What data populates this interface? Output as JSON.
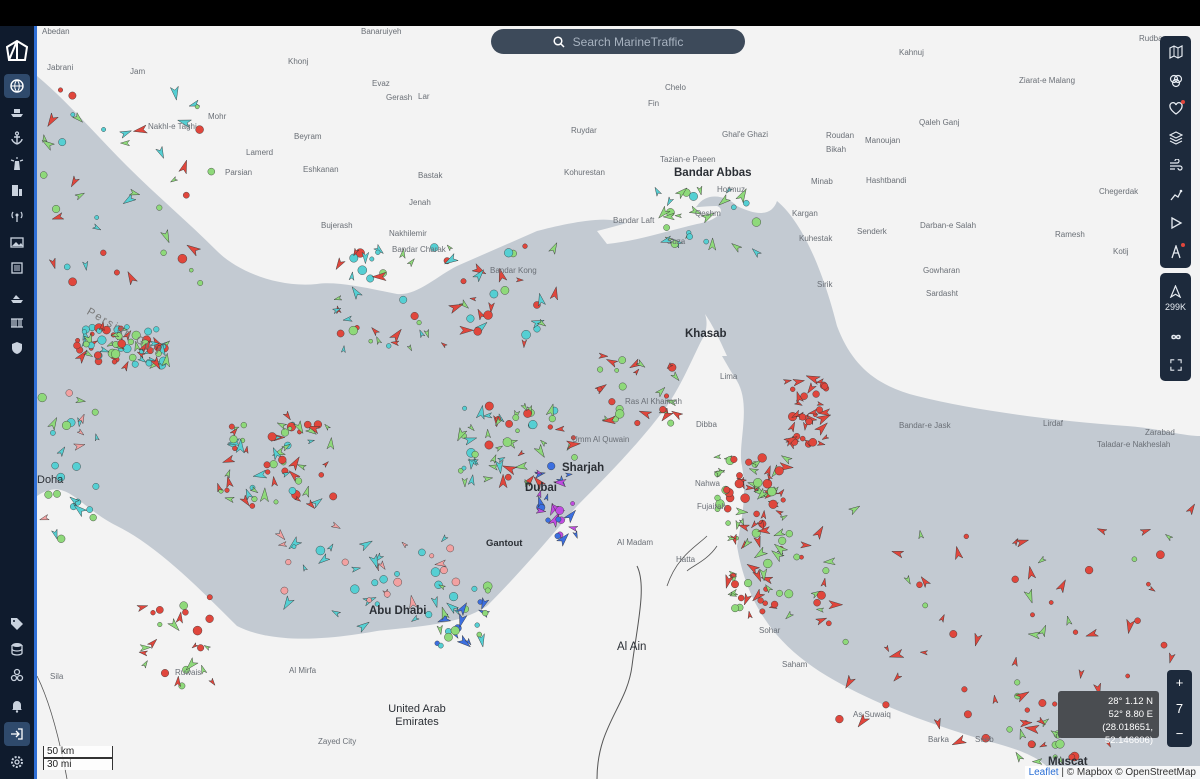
{
  "search": {
    "placeholder": "Search MarineTraffic"
  },
  "sidebar": {
    "items": [
      {
        "icon": "globe-icon",
        "active": true
      },
      {
        "icon": "ship-icon"
      },
      {
        "icon": "anchor-icon"
      },
      {
        "icon": "lighthouse-icon"
      },
      {
        "icon": "building-icon"
      },
      {
        "icon": "antenna-icon"
      },
      {
        "icon": "photo-icon"
      },
      {
        "icon": "news-icon"
      },
      {
        "icon": "fleet-icon"
      },
      {
        "icon": "barcode-icon"
      },
      {
        "icon": "shield-icon"
      }
    ],
    "bottom_items": [
      {
        "icon": "tag-icon"
      },
      {
        "icon": "database-icon"
      },
      {
        "icon": "cubes-icon"
      },
      {
        "icon": "bell-icon"
      },
      {
        "icon": "login-icon",
        "active": true
      },
      {
        "icon": "settings-icon"
      }
    ]
  },
  "right_tools": [
    {
      "icon": "map-icon"
    },
    {
      "icon": "filter-icon"
    },
    {
      "icon": "heart-icon",
      "badge": true
    },
    {
      "icon": "layers-icon"
    },
    {
      "icon": "weather-icon"
    },
    {
      "icon": "route-icon"
    },
    {
      "icon": "play-icon"
    },
    {
      "icon": "measure-icon",
      "badge": true
    }
  ],
  "vessel_count": {
    "label": "299K"
  },
  "coords": {
    "lat": "28° 1.12 N",
    "lon": "52° 8.80 E",
    "decimal": "(28.018651, 52.146606)"
  },
  "zoom": {
    "level": "7",
    "plus": "+",
    "minus": "−"
  },
  "scale": {
    "km": "50 km",
    "mi": "30 mi"
  },
  "attribution": {
    "leaflet": "Leaflet",
    "rest": " | © Mapbox © OpenStreetMap"
  },
  "labels": {
    "cities": [
      {
        "name": "Bandar Abbas"
      },
      {
        "name": "Khasab"
      },
      {
        "name": "Dubai"
      },
      {
        "name": "Sharjah"
      },
      {
        "name": "Abu Dhabi"
      },
      {
        "name": "Al Ain"
      },
      {
        "name": "Muscat"
      },
      {
        "name": "Gantout"
      }
    ],
    "towns": [
      "Abedan",
      "Banaruiyeh",
      "Rudbar",
      "Jabrani",
      "Kahnuj",
      "Khonj",
      "Jam",
      "Evaz",
      "Chelo",
      "Ziarat-e Malang",
      "Gerash",
      "Lar",
      "Fin",
      "Mohr",
      "Nakhl-e Taghi",
      "Beyram",
      "Ruydar",
      "Ghal'e Ghazi",
      "Roudan",
      "Manoujan",
      "Qaleh Ganj",
      "Lamerd",
      "Eshkanan",
      "Bikah",
      "Parsian",
      "Kohurestan",
      "Bastak",
      "Tazian-e Paeen",
      "Minab",
      "Hashtbandi",
      "Chegerdak",
      "Jenah",
      "Hormuz",
      "Qeshm",
      "Kargan",
      "Bujerash",
      "Nakhilemir",
      "Bandar Laft",
      "Bandar Charak",
      "Suza",
      "Kuhestak",
      "Senderk",
      "Darban-e Salah",
      "Ramesh",
      "Kotij",
      "Bandar Kong",
      "Gowharan",
      "Sardasht",
      "Sirik",
      "Lima",
      "Ras Al Khaimah",
      "Dibba",
      "Umm Al Quwain",
      "Nahwa",
      "Fujairah",
      "Bandar-e Jask",
      "Lirdaf",
      "Zarabad",
      "Taladar-e Nakheslah",
      "Al Madam",
      "Hatta",
      "Sohar",
      "Saham",
      "Al Mirfa",
      "Sila",
      "Ruwais",
      "As Suwaiq",
      "Barka",
      "Seeb",
      "Zayed City",
      "Doha"
    ],
    "country": "United Arab Emirates",
    "sea": "Persian Gulf"
  },
  "colors": {
    "water": "#c3cad2",
    "land": "#f3f3f3",
    "tanker": "#e0463c",
    "cargo": "#8ed97a",
    "fishing": "#55cfd3",
    "passenger": "#3c6fe0",
    "pleasure": "#c04be0",
    "other": "#f2a1a1"
  }
}
